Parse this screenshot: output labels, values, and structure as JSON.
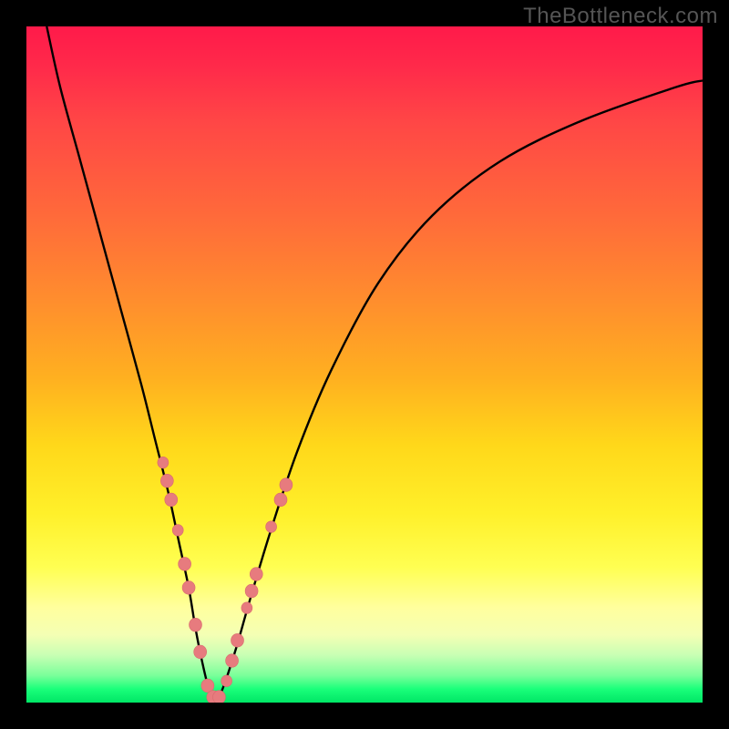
{
  "watermark": "TheBottleneck.com",
  "colors": {
    "curve_stroke": "#000000",
    "marker_fill": "#e77b7e",
    "marker_stroke": "#d96a6d"
  },
  "chart_data": {
    "type": "line",
    "title": "",
    "xlabel": "",
    "ylabel": "",
    "xlim": [
      0,
      100
    ],
    "ylim": [
      0,
      100
    ],
    "series": [
      {
        "name": "bottleneck-curve",
        "x": [
          3,
          5,
          8,
          11,
          14,
          17,
          19,
          21,
          22.5,
          24,
          25,
          26,
          27,
          28,
          29,
          31,
          33,
          36,
          40,
          45,
          52,
          60,
          70,
          82,
          96,
          100
        ],
        "y": [
          100,
          91,
          80,
          69,
          58,
          47,
          39,
          31,
          24,
          17,
          11,
          6,
          2,
          0.5,
          2,
          8,
          15,
          25,
          37,
          49,
          62,
          72,
          80,
          86,
          91,
          92
        ]
      }
    ],
    "markers": [
      {
        "x": 20.2,
        "y": 35.5,
        "r": 6
      },
      {
        "x": 20.8,
        "y": 32.8,
        "r": 7
      },
      {
        "x": 21.4,
        "y": 30.0,
        "r": 7
      },
      {
        "x": 22.4,
        "y": 25.5,
        "r": 6
      },
      {
        "x": 23.4,
        "y": 20.5,
        "r": 7
      },
      {
        "x": 24.0,
        "y": 17.0,
        "r": 7
      },
      {
        "x": 25.0,
        "y": 11.5,
        "r": 7
      },
      {
        "x": 25.7,
        "y": 7.5,
        "r": 7
      },
      {
        "x": 26.8,
        "y": 2.5,
        "r": 7
      },
      {
        "x": 27.6,
        "y": 0.8,
        "r": 7
      },
      {
        "x": 28.5,
        "y": 0.8,
        "r": 7
      },
      {
        "x": 29.6,
        "y": 3.2,
        "r": 6
      },
      {
        "x": 30.4,
        "y": 6.2,
        "r": 7
      },
      {
        "x": 31.2,
        "y": 9.2,
        "r": 7
      },
      {
        "x": 32.6,
        "y": 14.0,
        "r": 6
      },
      {
        "x": 33.3,
        "y": 16.5,
        "r": 7
      },
      {
        "x": 34.0,
        "y": 19.0,
        "r": 7
      },
      {
        "x": 36.2,
        "y": 26.0,
        "r": 6
      },
      {
        "x": 37.6,
        "y": 30.0,
        "r": 7
      },
      {
        "x": 38.4,
        "y": 32.2,
        "r": 7
      }
    ]
  }
}
